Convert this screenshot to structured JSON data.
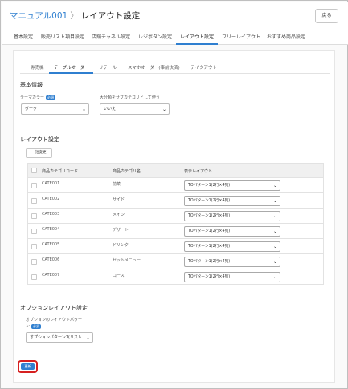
{
  "header": {
    "breadcrumb_link": "マニュアル001",
    "breadcrumb_sep": "〉",
    "breadcrumb_current": "レイアウト設定",
    "back_label": "戻る"
  },
  "top_tabs": [
    "基本設定",
    "販売リスト項目設定",
    "店舗チャネル設定",
    "レジボタン設定",
    "レイアウト設定",
    "フリーレイアウト",
    "おすすめ商品設定"
  ],
  "sub_tabs": [
    "券売機",
    "テーブルオーダー",
    "リテール",
    "スマホオーダー(事前決済)",
    "テイクアウト"
  ],
  "basic": {
    "title": "基本情報",
    "theme_label": "テーマカラー",
    "required": "必須",
    "theme_value": "ダーク",
    "subcat_label": "大分類をサブカテゴリとして使う",
    "subcat_value": "いいえ"
  },
  "layout": {
    "title": "レイアウト設定",
    "bulk_label": "一括変更",
    "col_code": "商品カテゴリコード",
    "col_name": "商品カテゴリ名",
    "col_layout": "表示レイアウト",
    "rows": [
      {
        "code": "CATE001",
        "name": "前菜",
        "layout": "TOパターン1(2行×4列)"
      },
      {
        "code": "CATE002",
        "name": "サイド",
        "layout": "TOパターン1(2行×4列)"
      },
      {
        "code": "CATE003",
        "name": "メイン",
        "layout": "TOパターン1(2行×4列)"
      },
      {
        "code": "CATE004",
        "name": "デザート",
        "layout": "TOパターン1(2行×4列)"
      },
      {
        "code": "CATE005",
        "name": "ドリンク",
        "layout": "TOパターン1(2行×4列)"
      },
      {
        "code": "CATE006",
        "name": "セットメニュー",
        "layout": "TOパターン1(2行×4列)"
      },
      {
        "code": "CATE007",
        "name": "コース",
        "layout": "TOパターン1(2行×4列)"
      }
    ]
  },
  "option": {
    "title": "オプションレイアウト設定",
    "label_line1": "オプションのレイアウトパター",
    "label_line2": "ン",
    "value": "オプションパターン1(リスト"
  },
  "save_label": "更新",
  "colors": {
    "accent": "#2f7fd0",
    "highlight": "#d62020"
  }
}
